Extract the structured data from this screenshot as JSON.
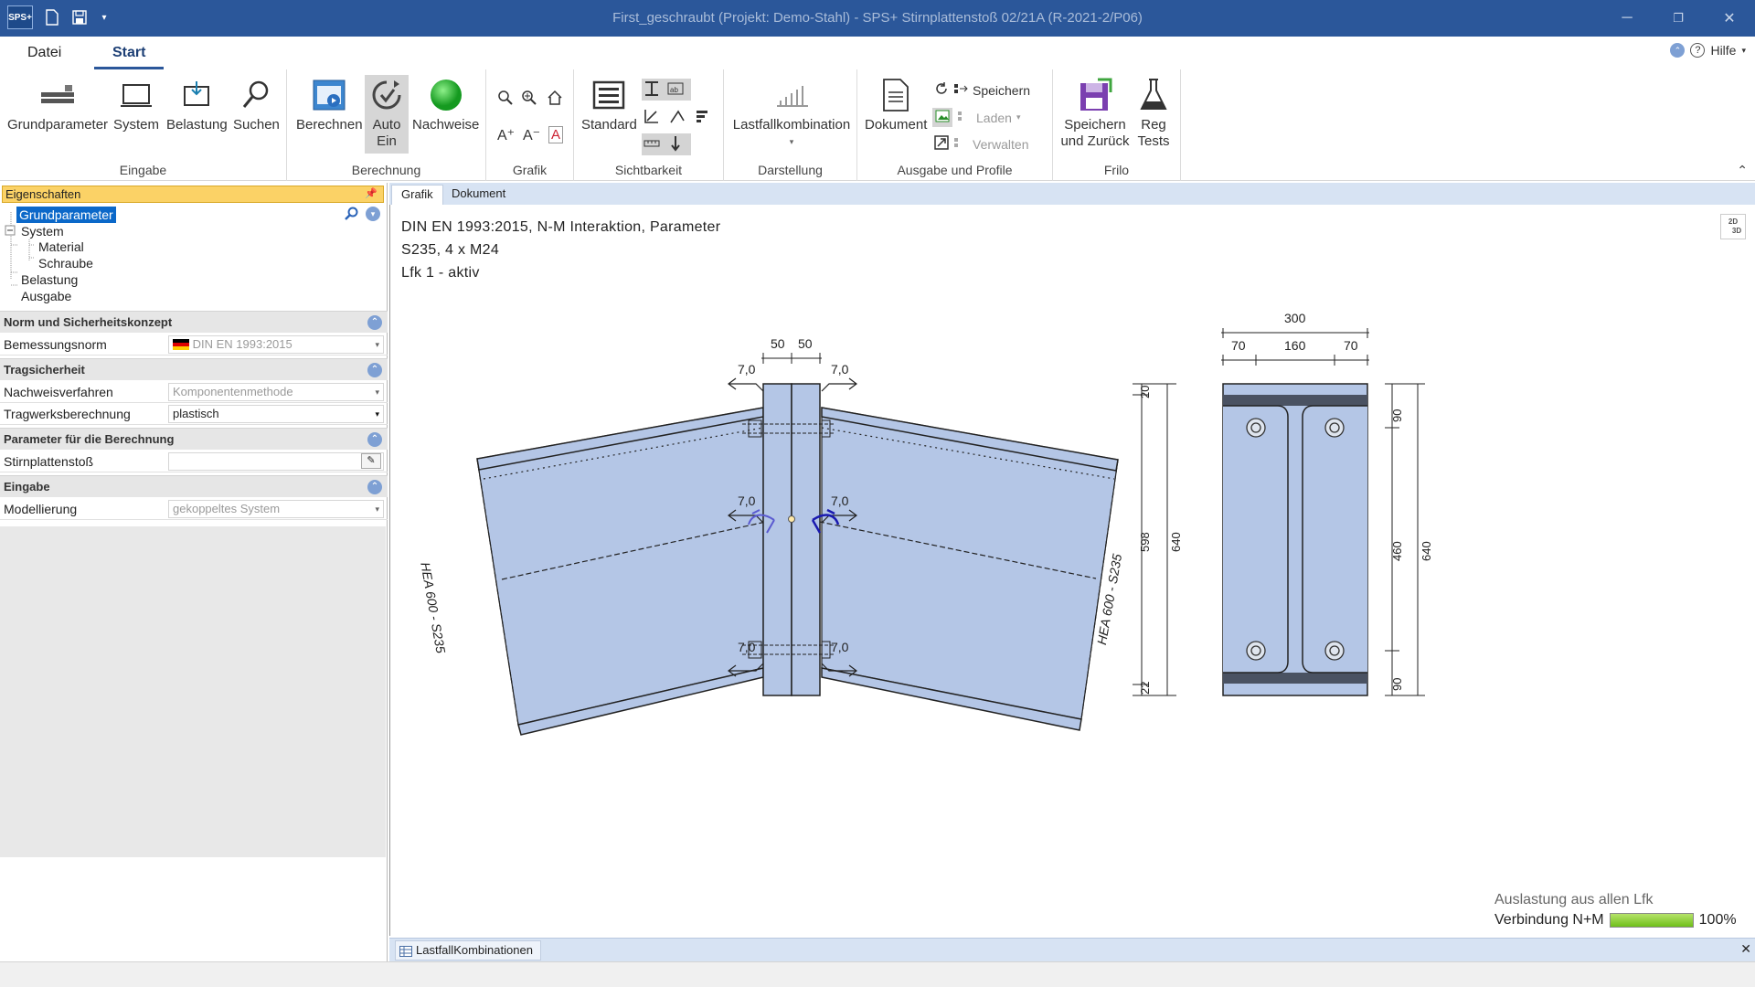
{
  "titlebar": {
    "app_icon": "SPS+",
    "title": "First_geschraubt (Projekt: Demo-Stahl) - SPS+ Stirnplattenstoß 02/21A (R-2021-2/P06)",
    "minimize_icon": "minimize-icon",
    "restore_icon": "restore-icon",
    "close_icon": "close-icon"
  },
  "tabs": {
    "file": "Datei",
    "start": "Start"
  },
  "help": {
    "label": "Hilfe"
  },
  "ribbon": {
    "eingabe": {
      "label": "Eingabe",
      "grundparameter": "Grundparameter",
      "system": "System",
      "belastung": "Belastung",
      "suchen": "Suchen"
    },
    "berechnung": {
      "label": "Berechnung",
      "berechnen": "Berechnen",
      "auto_line1": "Auto",
      "auto_line2": "Ein",
      "nachweise": "Nachweise"
    },
    "grafik": {
      "label": "Grafik"
    },
    "sichtbarkeit": {
      "label": "Sichtbarkeit",
      "standard": "Standard"
    },
    "darstellung": {
      "label": "Darstellung",
      "lastfallkombination": "Lastfallkombination"
    },
    "ausgabe": {
      "label": "Ausgabe und Profile",
      "dokument": "Dokument",
      "speichern": "Speichern",
      "laden": "Laden",
      "verwalten": "Verwalten"
    },
    "frilo": {
      "label": "Frilo",
      "speichern_line1": "Speichern",
      "speichern_line2": "und Zurück",
      "reg_line1": "Reg",
      "reg_line2": "Tests"
    }
  },
  "properties": {
    "header": "Eigenschaften",
    "tree": {
      "grundparameter": "Grundparameter",
      "system": "System",
      "material": "Material",
      "schraube": "Schraube",
      "belastung": "Belastung",
      "ausgabe": "Ausgabe"
    },
    "sections": {
      "norm": "Norm und Sicherheitskonzept",
      "trag": "Tragsicherheit",
      "param": "Parameter für die Berechnung",
      "eingabe": "Eingabe"
    },
    "rows": {
      "bemessungsnorm_label": "Bemessungsnorm",
      "bemessungsnorm_value": "DIN EN 1993:2015",
      "nachweisverfahren_label": "Nachweisverfahren",
      "nachweisverfahren_value": "Komponentenmethode",
      "tragwerksberechnung_label": "Tragwerksberechnung",
      "tragwerksberechnung_value": "plastisch",
      "stirnplattenstoss_label": "Stirnplattenstoß",
      "modellierung_label": "Modellierung",
      "modellierung_value": "gekoppeltes System"
    }
  },
  "doc_tabs": {
    "grafik": "Grafik",
    "dokument": "Dokument"
  },
  "drawing": {
    "info_line1": "DIN EN 1993:2015, N-M Interaktion, Parameter",
    "info_line2": "S235, 4 x M24",
    "info_line3": "Lfk 1 - aktiv",
    "view_toggle_2d": "2D",
    "view_toggle_3d": "3D",
    "weld_label": "7,0",
    "top_dim_left": "50",
    "top_dim_right": "50",
    "profile_left": "HEA 600 - S235",
    "profile_right": "HEA 600 - S235",
    "side_dims": {
      "top": "20",
      "mid": "598",
      "bottom": "22",
      "total": "640"
    },
    "plate_dims": {
      "width": "300",
      "left": "70",
      "mid": "160",
      "right": "70",
      "top": "90",
      "middle": "460",
      "bottom": "90",
      "total": "640"
    },
    "auslastung_title": "Auslastung aus allen Lfk",
    "auslastung_label": "Verbindung N+M",
    "auslastung_value": "100%",
    "auslastung_fraction": 1.0
  },
  "bottom_tab": {
    "label": "LastfallKombinationen"
  },
  "colors": {
    "titlebar": "#2b579a",
    "props_header": "#fbd266",
    "selection": "#0b68c9",
    "beam_fill": "#b4c6e6",
    "plate_flange": "#4a5262",
    "utilization": "#8cd13b"
  }
}
